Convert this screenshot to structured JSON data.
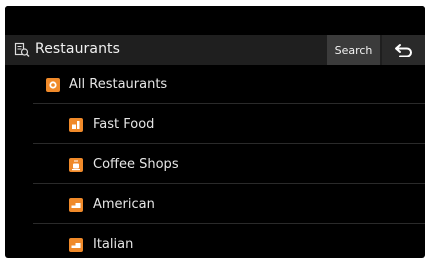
{
  "header": {
    "title": "Restaurants",
    "search_label": "Search",
    "icon": "restaurant-search-icon",
    "back_icon": "back-arrow-icon"
  },
  "list": {
    "items": [
      {
        "label": "All Restaurants",
        "icon": "all-restaurants-icon"
      },
      {
        "label": "Fast Food",
        "icon": "fast-food-icon"
      },
      {
        "label": "Coffee Shops",
        "icon": "coffee-icon"
      },
      {
        "label": "American",
        "icon": "american-food-icon"
      },
      {
        "label": "Italian",
        "icon": "italian-food-icon"
      }
    ]
  },
  "colors": {
    "accent": "#f08a2a",
    "background": "#000000",
    "header_bg": "#1f1f1f",
    "search_bg": "#3b3b3b"
  }
}
